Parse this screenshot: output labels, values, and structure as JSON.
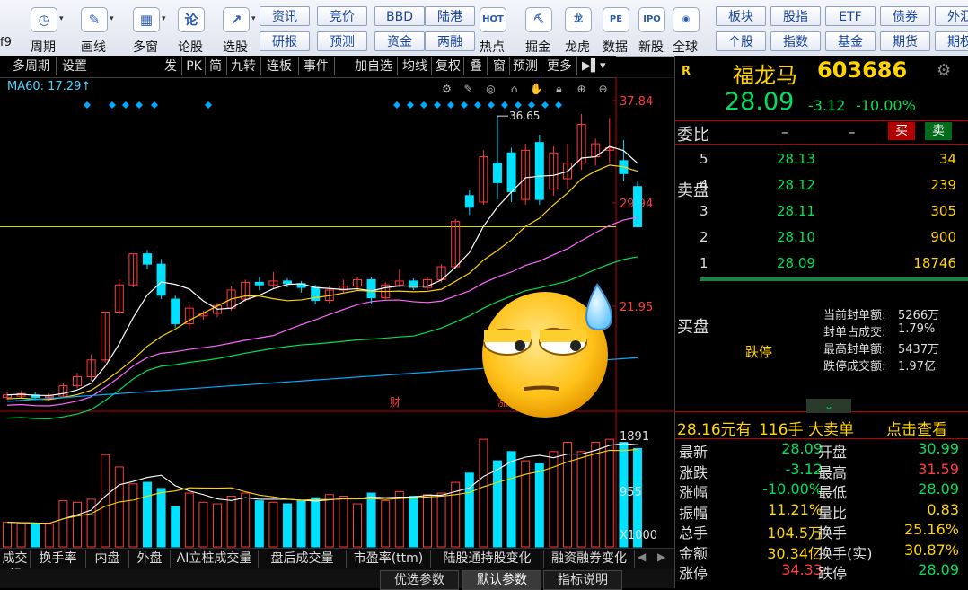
{
  "toolbar": {
    "big_buttons": [
      {
        "label": "周期",
        "icon": "period-icon",
        "glyph": "◷"
      },
      {
        "label": "画线",
        "icon": "pencil-icon",
        "glyph": "✎"
      },
      {
        "label": "多窗",
        "icon": "multi-window-icon",
        "glyph": "▦"
      },
      {
        "label": "论股",
        "icon": "discuss-icon",
        "glyph": "论"
      },
      {
        "label": "选股",
        "icon": "stock-picker-icon",
        "glyph": "↗"
      }
    ],
    "grid_top": [
      "资讯",
      "竞价",
      "BBD",
      "陆港"
    ],
    "grid_bottom": [
      "研报",
      "预测",
      "资金",
      "两融"
    ],
    "mid_buttons": [
      {
        "label": "热点",
        "icon": "hot-icon",
        "glyph": "HOT"
      },
      {
        "label": "掘金",
        "icon": "gold-digging-icon",
        "glyph": "⛏"
      },
      {
        "label": "龙虎",
        "icon": "dragon-tiger-icon",
        "glyph": "龙"
      },
      {
        "label": "数据",
        "icon": "data-icon",
        "glyph": "PE"
      },
      {
        "label": "新股",
        "icon": "ipo-icon",
        "glyph": "IPO"
      },
      {
        "label": "全球",
        "icon": "globe-icon",
        "glyph": "◉"
      }
    ],
    "grid2_top": [
      "板块",
      "股指",
      "ETF",
      "债券",
      "外汇"
    ],
    "grid2_bottom": [
      "个股",
      "指数",
      "基金",
      "期货",
      "期权"
    ],
    "left_partial": "f9"
  },
  "chart_tabs": [
    "多周期",
    "设置",
    "发",
    "PK",
    "简",
    "九转",
    "连板",
    "事件",
    "加自选",
    "均线",
    "复权",
    "叠",
    "窗",
    "预测",
    "更多"
  ],
  "ma_label": "MA60: 17.29↑",
  "price_axis": [
    "37.84",
    "29.94",
    "21.95"
  ],
  "max_marker": "36.65",
  "event_markers": [
    "财",
    "涨"
  ],
  "volume_axis": [
    "1891",
    "955",
    "X1000"
  ],
  "chart_data": {
    "type": "candlestick",
    "candles": [
      {
        "o": 14.9,
        "c": 15.1,
        "h": 15.3,
        "l": 14.7
      },
      {
        "o": 15.0,
        "c": 15.2,
        "h": 15.4,
        "l": 14.8
      },
      {
        "o": 15.1,
        "c": 14.9,
        "h": 15.3,
        "l": 14.7
      },
      {
        "o": 14.9,
        "c": 15.0,
        "h": 15.2,
        "l": 14.6
      },
      {
        "o": 15.0,
        "c": 15.8,
        "h": 16.0,
        "l": 14.9
      },
      {
        "o": 15.8,
        "c": 16.5,
        "h": 16.8,
        "l": 15.6
      },
      {
        "o": 16.5,
        "c": 17.8,
        "h": 18.2,
        "l": 16.2
      },
      {
        "o": 17.8,
        "c": 21.5,
        "h": 21.5,
        "l": 17.6
      },
      {
        "o": 21.5,
        "c": 23.6,
        "h": 24.0,
        "l": 21.3
      },
      {
        "o": 23.6,
        "c": 26.0,
        "h": 26.0,
        "l": 23.4
      },
      {
        "o": 26.0,
        "c": 25.2,
        "h": 26.3,
        "l": 24.8
      },
      {
        "o": 25.2,
        "c": 22.8,
        "h": 25.6,
        "l": 22.5
      },
      {
        "o": 22.5,
        "c": 20.6,
        "h": 22.8,
        "l": 20.3
      },
      {
        "o": 20.6,
        "c": 21.8,
        "h": 22.1,
        "l": 20.2
      },
      {
        "o": 21.2,
        "c": 21.4,
        "h": 21.6,
        "l": 20.9
      },
      {
        "o": 21.4,
        "c": 22.0,
        "h": 22.2,
        "l": 21.1
      },
      {
        "o": 21.8,
        "c": 23.2,
        "h": 23.5,
        "l": 21.6
      },
      {
        "o": 22.5,
        "c": 23.8,
        "h": 24.0,
        "l": 22.3
      },
      {
        "o": 23.8,
        "c": 23.6,
        "h": 24.2,
        "l": 23.2
      },
      {
        "o": 23.6,
        "c": 23.9,
        "h": 24.6,
        "l": 23.3
      },
      {
        "o": 23.9,
        "c": 23.7,
        "h": 24.1,
        "l": 23.4
      },
      {
        "o": 23.7,
        "c": 23.4,
        "h": 23.9,
        "l": 23.0
      },
      {
        "o": 23.4,
        "c": 22.4,
        "h": 23.6,
        "l": 22.1
      },
      {
        "o": 22.4,
        "c": 23.2,
        "h": 23.5,
        "l": 22.2
      },
      {
        "o": 23.2,
        "c": 23.5,
        "h": 24.0,
        "l": 23.0
      },
      {
        "o": 23.5,
        "c": 24.0,
        "h": 24.2,
        "l": 23.2
      },
      {
        "o": 24.0,
        "c": 22.6,
        "h": 24.2,
        "l": 22.1
      },
      {
        "o": 22.6,
        "c": 23.6,
        "h": 23.8,
        "l": 22.5
      },
      {
        "o": 23.6,
        "c": 23.9,
        "h": 24.8,
        "l": 23.4
      },
      {
        "o": 23.9,
        "c": 23.4,
        "h": 24.1,
        "l": 23.2
      },
      {
        "o": 23.4,
        "c": 24.0,
        "h": 24.2,
        "l": 23.2
      },
      {
        "o": 24.0,
        "c": 25.0,
        "h": 25.2,
        "l": 23.8
      },
      {
        "o": 25.0,
        "c": 28.5,
        "h": 28.7,
        "l": 24.8
      },
      {
        "o": 30.5,
        "c": 29.6,
        "h": 30.9,
        "l": 29.0
      },
      {
        "o": 30.0,
        "c": 33.5,
        "h": 34.0,
        "l": 29.8
      },
      {
        "o": 33.0,
        "c": 31.5,
        "h": 36.65,
        "l": 30.2
      },
      {
        "o": 33.8,
        "c": 30.8,
        "h": 34.2,
        "l": 30.0
      },
      {
        "o": 30.2,
        "c": 34.0,
        "h": 34.5,
        "l": 29.8
      },
      {
        "o": 34.6,
        "c": 30.2,
        "h": 35.2,
        "l": 29.8
      },
      {
        "o": 31.0,
        "c": 33.8,
        "h": 34.3,
        "l": 30.5
      },
      {
        "o": 31.8,
        "c": 33.0,
        "h": 34.5,
        "l": 31.0
      },
      {
        "o": 33.0,
        "c": 36.0,
        "h": 36.8,
        "l": 32.5
      },
      {
        "o": 33.5,
        "c": 34.5,
        "h": 34.9,
        "l": 32.8
      },
      {
        "o": 34.0,
        "c": 34.2,
        "h": 36.5,
        "l": 33.0
      },
      {
        "o": 33.2,
        "c": 32.2,
        "h": 34.8,
        "l": 31.6
      },
      {
        "o": 31.2,
        "c": 28.09,
        "h": 31.59,
        "l": 28.09
      }
    ],
    "volumes": [
      160,
      155,
      150,
      148,
      300,
      290,
      310,
      600,
      520,
      410,
      420,
      380,
      260,
      350,
      290,
      280,
      330,
      350,
      300,
      290,
      280,
      300,
      320,
      340,
      330,
      280,
      350,
      300,
      360,
      330,
      340,
      350,
      420,
      480,
      700,
      560,
      620,
      560,
      540,
      620,
      680,
      620,
      680,
      700,
      680,
      640
    ],
    "ma_close_y_ref": "MA60"
  },
  "panel": {
    "flag": "R",
    "stock_name": "福龙马",
    "stock_code": "603686",
    "price": "28.09",
    "change": "-3.12",
    "change_pct": "-10.00%",
    "weibi_label": "委比",
    "weibi_val1": "–",
    "weibi_val2": "–",
    "buy_label": "买",
    "sell_label": "卖",
    "sell_side_label": "卖盘",
    "buy_side_label": "买盘",
    "asks": [
      {
        "level": "5",
        "price": "28.13",
        "vol": "34"
      },
      {
        "level": "4",
        "price": "28.12",
        "vol": "239"
      },
      {
        "level": "3",
        "price": "28.11",
        "vol": "305"
      },
      {
        "level": "2",
        "price": "28.10",
        "vol": "900"
      },
      {
        "level": "1",
        "price": "28.09",
        "vol": "18746"
      }
    ],
    "limit_status": "跌停",
    "seal_info": [
      {
        "k": "当前封单额:",
        "v": "5266万"
      },
      {
        "k": "封单占成交:",
        "v": "1.79%"
      },
      {
        "k": "最高封单额:",
        "v": "5437万"
      },
      {
        "k": "跌停成交额:",
        "v": "1.97亿"
      }
    ],
    "big_order": {
      "price": "28.16元有",
      "qty": "116手",
      "type": "大卖单",
      "link": "点击查看"
    },
    "quotes": [
      {
        "k": "最新",
        "v": "28.09",
        "vc": "g",
        "k2": "开盘",
        "v2": "30.99",
        "v2c": "g"
      },
      {
        "k": "涨跌",
        "v": "-3.12",
        "vc": "g",
        "k2": "最高",
        "v2": "31.59",
        "v2c": "red"
      },
      {
        "k": "涨幅",
        "v": "-10.00%",
        "vc": "g",
        "k2": "最低",
        "v2": "28.09",
        "v2c": "g"
      },
      {
        "k": "振幅",
        "v": "11.21%",
        "vc": "yel",
        "k2": "量比",
        "v2": "0.83",
        "v2c": "yel"
      },
      {
        "k": "总手",
        "v": "104.5万",
        "vc": "yel",
        "k2": "换手",
        "v2": "25.16%",
        "v2c": "yel"
      },
      {
        "k": "金额",
        "v": "30.34亿",
        "vc": "yel",
        "k2": "换手(实)",
        "v2": "30.87%",
        "v2c": "yel"
      },
      {
        "k": "涨停",
        "v": "34.33",
        "vc": "red",
        "k2": "跌停",
        "v2": "28.09",
        "v2c": "g"
      }
    ]
  },
  "indicator_tabs": [
    "成交额",
    "换手率",
    "内盘",
    "外盘",
    "AI立桩成交量",
    "盘后成交量",
    "市盈率(ttm)",
    "陆股通持股变化",
    "融资融券变化"
  ],
  "param_tabs": [
    "优选参数",
    "默认参数",
    "指标说明"
  ],
  "colors": {
    "up": "#ff3c3c",
    "down": "#00e0ff",
    "ma5": "#ffffff",
    "ma10": "#ffd400",
    "ma20": "#ff66ff",
    "ma30": "#00dd55",
    "ma60": "#00aaff"
  }
}
